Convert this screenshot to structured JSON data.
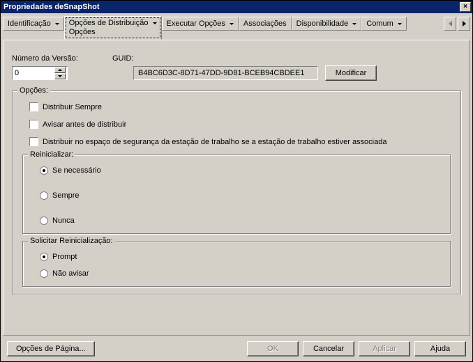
{
  "window": {
    "title": "Propriedades deSnapShot",
    "close_icon": "×"
  },
  "tabs": {
    "identificacao": "Identificação",
    "opcoes_distribuicao": "Opções de Distribuição",
    "opcoes_sub": "Opções",
    "executar_opcoes": "Executar Opções",
    "associacoes": "Associações",
    "disponibilidade": "Disponibilidade",
    "comum": "Comum"
  },
  "labels": {
    "numero_versao": "Número da Versão:",
    "guid": "GUID:"
  },
  "fields": {
    "version_value": "0",
    "guid_value": "B4BC6D3C-8D71-47DD-9D81-BCEB94CBDEE1"
  },
  "buttons": {
    "modificar": "Modificar",
    "opcoes_pagina": "Opções de Página...",
    "ok": "OK",
    "cancelar": "Cancelar",
    "aplicar": "Aplicar",
    "ajuda": "Ajuda"
  },
  "groups": {
    "opcoes_legend": "Opções:",
    "reinicializar_legend": "Reinicializar:",
    "solicitar_legend": "Solicitar Reinicialização:"
  },
  "checks": {
    "distribuir_sempre": "Distribuir Sempre",
    "avisar_antes": "Avisar antes de distribuir",
    "distribuir_espaco": "Distribuir no espaço de segurança da estação de trabalho se a estação de trabalho estiver associada"
  },
  "reinicializar": {
    "se_necessario": "Se necessário",
    "sempre": "Sempre",
    "nunca": "Nunca"
  },
  "solicitar": {
    "prompt": "Prompt",
    "nao_avisar": "Não avisar"
  }
}
